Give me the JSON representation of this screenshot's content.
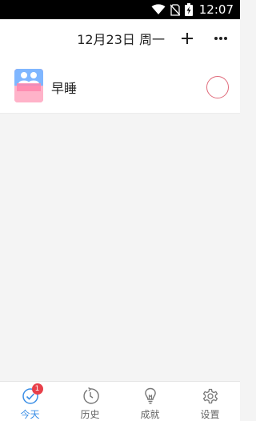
{
  "status_bar": {
    "time": "12:07",
    "icons": [
      "wifi-icon",
      "no-sim-icon",
      "battery-charging-icon"
    ]
  },
  "header": {
    "date_label": "12月23日 周一",
    "add_icon": "plus-icon",
    "more_icon": "more-icon"
  },
  "habits": [
    {
      "name": "早睡",
      "icon": "habit-thumbnail",
      "completed": false
    }
  ],
  "tabs": [
    {
      "label": "今天",
      "icon": "check-circle-icon",
      "active": true,
      "badge": "1"
    },
    {
      "label": "历史",
      "icon": "history-icon",
      "active": false
    },
    {
      "label": "成就",
      "icon": "lightbulb-icon",
      "active": false
    },
    {
      "label": "设置",
      "icon": "gear-icon",
      "active": false
    }
  ],
  "colors": {
    "accent": "#3a8ee6",
    "badge": "#e8404a",
    "check_ring": "#e06a7a",
    "background": "#f4f4f4"
  }
}
